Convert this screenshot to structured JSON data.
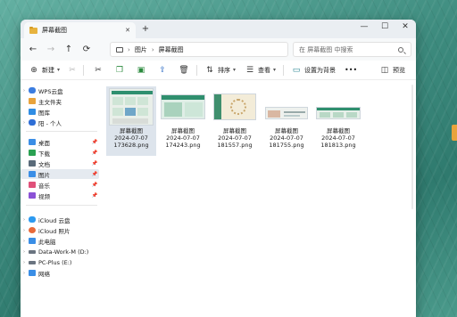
{
  "window": {
    "tab_title": "屏幕截图",
    "new_tab": "+",
    "minimize": "—",
    "maximize": "☐",
    "close": "✕"
  },
  "navigation": {
    "back": "←",
    "forward": "→",
    "up": "↑",
    "refresh": "⟳",
    "breadcrumb": [
      "图片",
      "屏幕截图"
    ],
    "search_placeholder": "在 屏幕截图 中搜索"
  },
  "toolbar": {
    "new_label": "新建",
    "sort_label": "排序",
    "view_label": "查看",
    "set_background_label": "设置为背景",
    "more_label": "•••",
    "preview_label": "预览",
    "icons": [
      "cut-icon",
      "copy-icon",
      "paste-icon",
      "rename-icon",
      "share-icon",
      "delete-icon"
    ]
  },
  "sidebar": {
    "group1": [
      {
        "label": "WPS云盘",
        "icon": "cloud-icon",
        "color": "#3b7de0"
      },
      {
        "label": "主文件夹",
        "icon": "home-icon",
        "color": "#e8a33c"
      },
      {
        "label": "图库",
        "icon": "gallery-icon",
        "color": "#2f8de4"
      },
      {
        "label": "阳 - 个人",
        "icon": "onedrive-icon",
        "color": "#2f6fd6"
      }
    ],
    "group2": [
      {
        "label": "桌面",
        "icon": "desktop-icon",
        "color": "#3a8ee6",
        "pinned": true
      },
      {
        "label": "下载",
        "icon": "download-icon",
        "color": "#2aa152",
        "pinned": true
      },
      {
        "label": "文档",
        "icon": "documents-icon",
        "color": "#5a6b7a",
        "pinned": true
      },
      {
        "label": "图片",
        "icon": "pictures-icon",
        "color": "#3a8ee6",
        "pinned": true,
        "selected": true
      },
      {
        "label": "音乐",
        "icon": "music-icon",
        "color": "#e0517a",
        "pinned": true
      },
      {
        "label": "视频",
        "icon": "video-icon",
        "color": "#8b52d6",
        "pinned": true
      }
    ],
    "group3": [
      {
        "label": "iCloud 云盘",
        "icon": "icloud-drive-icon",
        "color": "#2c9af0"
      },
      {
        "label": "iCloud 照片",
        "icon": "icloud-photos-icon",
        "color": "#e86a3a"
      },
      {
        "label": "此电脑",
        "icon": "this-pc-icon",
        "color": "#3a8ee6"
      },
      {
        "label": "Data-Work-M (D:)",
        "icon": "drive-icon",
        "color": "#6a7480"
      },
      {
        "label": "PC-Plus (E:)",
        "icon": "drive-icon",
        "color": "#6a7480"
      },
      {
        "label": "网络",
        "icon": "network-icon",
        "color": "#3a8ee6"
      }
    ]
  },
  "files": [
    {
      "name": "屏幕截图",
      "date": "2024-07-07",
      "id": "173628.png",
      "selected": true
    },
    {
      "name": "屏幕截图",
      "date": "2024-07-07",
      "id": "174243.png"
    },
    {
      "name": "屏幕截图",
      "date": "2024-07-07",
      "id": "181557.png"
    },
    {
      "name": "屏幕截图",
      "date": "2024-07-07",
      "id": "181755.png"
    },
    {
      "name": "屏幕截图",
      "date": "2024-07-07",
      "id": "181813.png"
    }
  ]
}
